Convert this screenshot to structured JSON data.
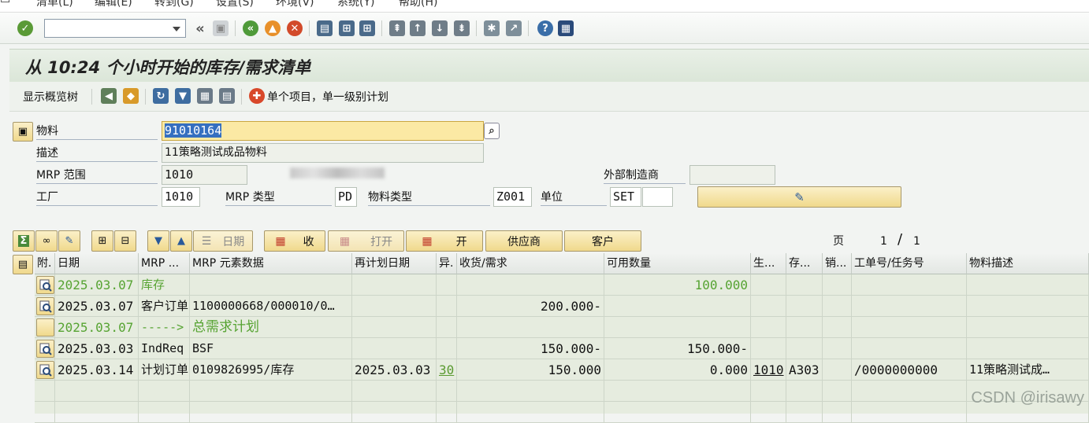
{
  "menubar": {
    "items": [
      "清单(L)",
      "编辑(E)",
      "转到(G)",
      "设置(S)",
      "环境(V)",
      "系统(Y)",
      "帮助(H)"
    ]
  },
  "toolbar": {
    "command_value": ""
  },
  "title": "从 10:24 个小时开始的库存/需求清单",
  "apptoolbar": {
    "show_tree": "显示概览树",
    "single_item": "单个项目，单一级别计划"
  },
  "form": {
    "material_label": "物料",
    "material_value": "91010164",
    "desc_label": "描述",
    "desc_value": "11策略测试成品物料",
    "mrp_area_label": "MRP 范围",
    "mrp_area_value": "1010",
    "ext_mfr_label": "外部制造商",
    "ext_mfr_value": "",
    "plant_label": "工厂",
    "plant_value": "1010",
    "mrp_type_label": "MRP 类型",
    "mrp_type_value": "PD",
    "mat_type_label": "物料类型",
    "mat_type_value": "Z001",
    "unit_label": "单位",
    "unit_value": "SET",
    "unit_extra": ""
  },
  "gridtoolbar": {
    "date_btn": "日期",
    "receipt_btn": "收",
    "open_btn": "打开",
    "on_btn": "开",
    "vendor_btn": "供应商",
    "customer_btn": "客户",
    "page_label": "页",
    "page_current": "1",
    "page_sep": "/",
    "page_total": "1"
  },
  "table": {
    "headers": [
      "附.",
      "日期",
      "MRP ...",
      "MRP 元素数据",
      "再计划日期",
      "异.",
      "收货/需求",
      "可用数量",
      "生...",
      "存...",
      "销...",
      "工单号/任务号",
      "物料描述"
    ],
    "rows": [
      {
        "date": "2025.03.07",
        "mrp": "库存",
        "data": "",
        "resched": "",
        "exc": "",
        "recv": "",
        "avail": "100.000",
        "prod": "",
        "stor": "",
        "sales": "",
        "order": "",
        "desc": "",
        "style": "green"
      },
      {
        "date": "2025.03.07",
        "mrp": "客户订单",
        "data": "1100000668/000010/0…",
        "resched": "",
        "exc": "",
        "recv": "200.000-",
        "avail": "",
        "prod": "",
        "stor": "",
        "sales": "",
        "order": "",
        "desc": "",
        "style": "normal"
      },
      {
        "date": "2025.03.07",
        "mrp": "----->",
        "data": "总需求计划",
        "resched": "",
        "exc": "",
        "recv": "",
        "avail": "",
        "prod": "",
        "stor": "",
        "sales": "",
        "order": "",
        "desc": "",
        "style": "green"
      },
      {
        "date": "2025.03.03",
        "mrp": "IndReq",
        "data": "BSF",
        "resched": "",
        "exc": "",
        "recv": "150.000-",
        "avail": "150.000-",
        "prod": "",
        "stor": "",
        "sales": "",
        "order": "",
        "desc": "",
        "style": "normal"
      },
      {
        "date": "2025.03.14",
        "mrp": "计划订单",
        "data": "0109826995/库存",
        "resched": "2025.03.03",
        "exc": "30",
        "recv": "150.000",
        "avail": "0.000",
        "prod": "1010",
        "stor": "A303",
        "sales": "",
        "order": "/0000000000",
        "desc": "11策略测试成…",
        "style": "normal"
      }
    ]
  },
  "watermark": "CSDN @irisawy"
}
